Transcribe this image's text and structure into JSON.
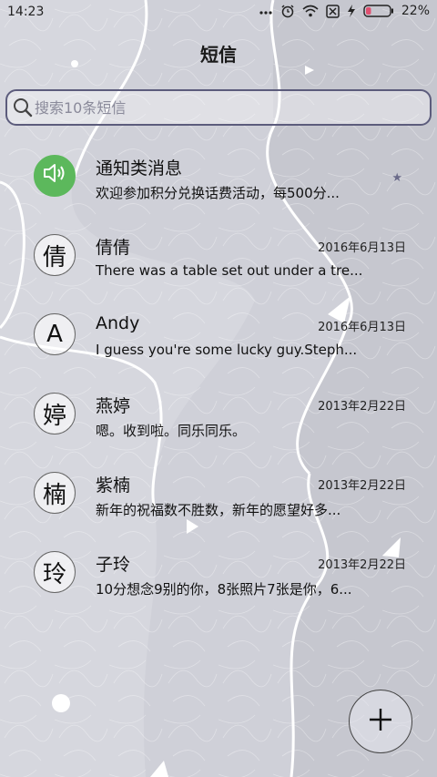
{
  "status_bar": {
    "time": "14:23",
    "battery_percent": "22%",
    "icons": [
      "more-dots-icon",
      "alarm-icon",
      "wifi-icon",
      "sim-icon",
      "charging-icon",
      "battery-icon"
    ],
    "battery_level": 0.22,
    "battery_color": "#e05070"
  },
  "header": {
    "title": "短信"
  },
  "search": {
    "placeholder": "搜索10条短信"
  },
  "messages": [
    {
      "avatar": "",
      "avatar_icon": "speaker-icon",
      "avatar_color": "#5cb85c",
      "name": "通知类消息",
      "date": "",
      "preview": "欢迎参加积分兑换话费活动，每500分...",
      "starred": true
    },
    {
      "avatar": "倩",
      "name": "倩倩",
      "date": "2016年6月13日",
      "preview": "There was a table set out under a tre..."
    },
    {
      "avatar": "A",
      "name": "Andy",
      "date": "2016年6月13日",
      "preview": "I guess you're some lucky guy.Steph..."
    },
    {
      "avatar": "婷",
      "name": "燕婷",
      "date": "2013年2月22日",
      "preview": "嗯。收到啦。同乐同乐。"
    },
    {
      "avatar": "楠",
      "name": "紫楠",
      "date": "2013年2月22日",
      "preview": "新年的祝福数不胜数，新年的愿望好多..."
    },
    {
      "avatar": "玲",
      "name": "子玲",
      "date": "2013年2月22日",
      "preview": "10分想念9别的你，8张照片7张是你，6..."
    }
  ],
  "fab": {
    "icon": "plus-icon"
  }
}
